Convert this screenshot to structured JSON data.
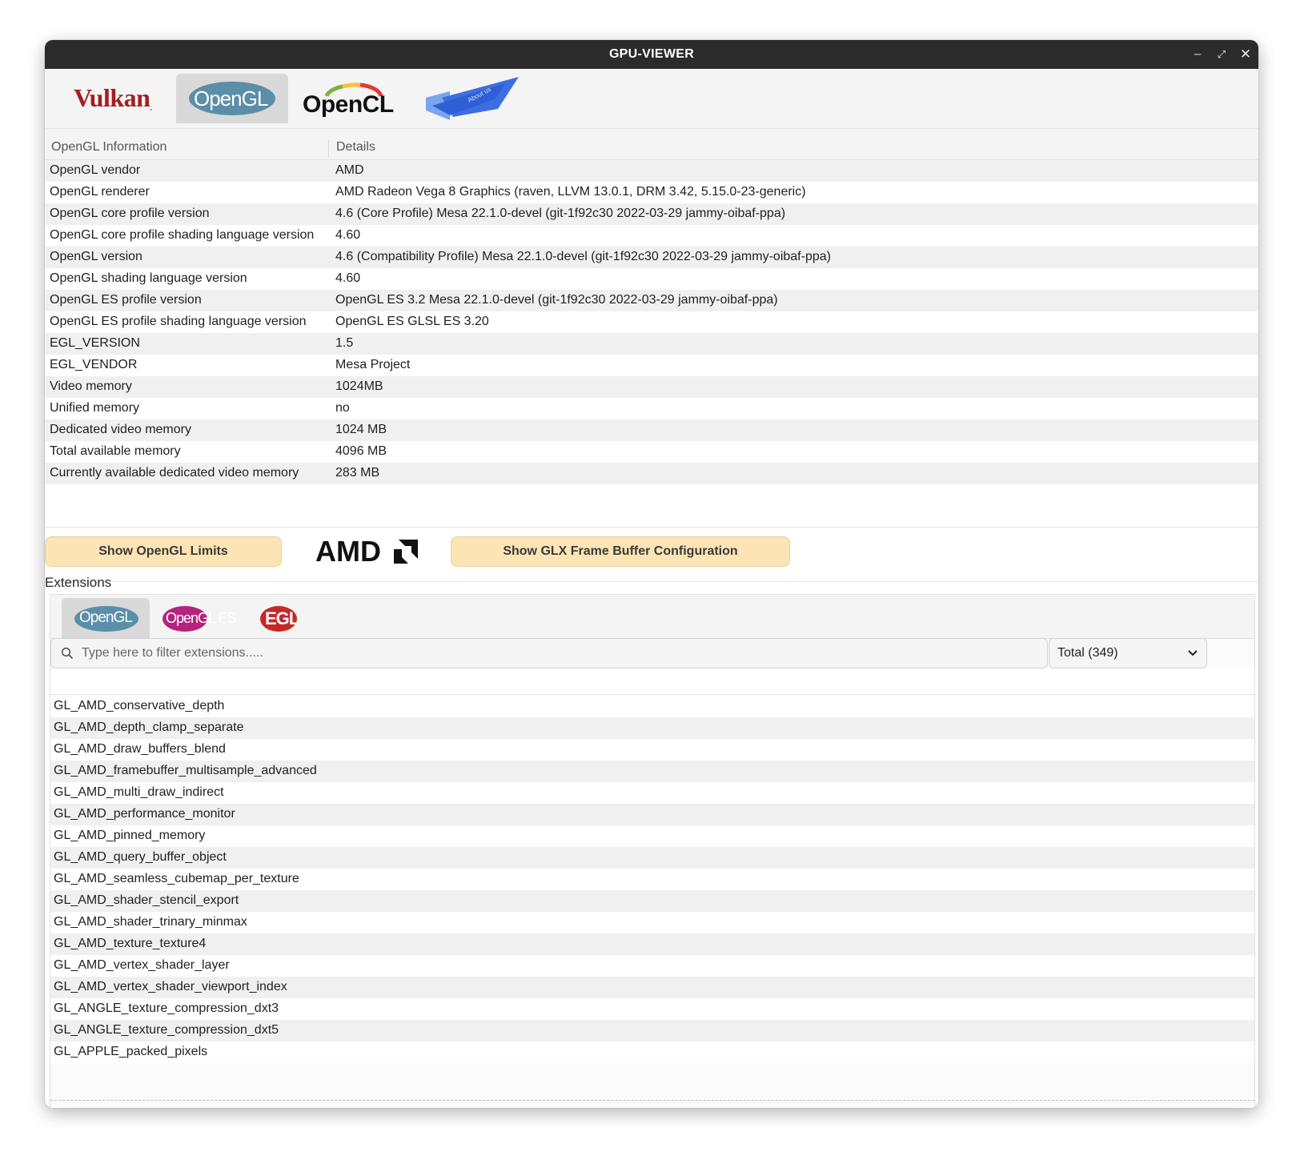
{
  "window": {
    "title": "GPU-VIEWER",
    "minimize": "–",
    "maximize": "⤢",
    "close": "✕"
  },
  "api_tabs": [
    {
      "label": "Vulkan",
      "active": false
    },
    {
      "label": "OpenGL",
      "active": true
    },
    {
      "label": "OpenCL",
      "active": false
    },
    {
      "label": "About us",
      "active": false
    }
  ],
  "info_table": {
    "headers": [
      "OpenGL Information",
      "Details"
    ],
    "rows": [
      [
        "OpenGL vendor",
        "AMD"
      ],
      [
        "OpenGL renderer",
        "AMD Radeon Vega 8 Graphics (raven, LLVM 13.0.1, DRM 3.42, 5.15.0-23-generic)"
      ],
      [
        "OpenGL core profile version",
        "4.6 (Core Profile) Mesa 22.1.0-devel (git-1f92c30 2022-03-29 jammy-oibaf-ppa)"
      ],
      [
        "OpenGL core profile shading language version",
        "4.60"
      ],
      [
        "OpenGL version",
        "4.6 (Compatibility Profile) Mesa 22.1.0-devel (git-1f92c30 2022-03-29 jammy-oibaf-ppa)"
      ],
      [
        "OpenGL shading language version",
        "4.60"
      ],
      [
        "OpenGL ES profile version",
        "OpenGL ES 3.2 Mesa 22.1.0-devel (git-1f92c30 2022-03-29 jammy-oibaf-ppa)"
      ],
      [
        "OpenGL ES profile shading language version",
        "OpenGL ES GLSL ES 3.20"
      ],
      [
        "EGL_VERSION",
        "1.5"
      ],
      [
        "EGL_VENDOR",
        "Mesa Project"
      ],
      [
        "Video memory",
        "1024MB"
      ],
      [
        "Unified memory",
        "no"
      ],
      [
        "Dedicated video memory",
        "1024 MB"
      ],
      [
        "Total available memory",
        "4096 MB"
      ],
      [
        "Currently available dedicated video memory",
        "283 MB"
      ]
    ]
  },
  "buttons": {
    "limits": "Show OpenGL Limits",
    "glx": "Show GLX Frame Buffer Configuration",
    "vendor_logo": "AMD"
  },
  "extensions": {
    "label": "Extensions",
    "tabs": [
      {
        "label": "OpenGL",
        "active": true
      },
      {
        "label": "OpenGL ES",
        "active": false
      },
      {
        "label": "EGL",
        "active": false
      }
    ],
    "search_placeholder": "Type here to filter extensions.....",
    "total": "Total (349)",
    "items": [
      "GL_AMD_conservative_depth",
      "GL_AMD_depth_clamp_separate",
      "GL_AMD_draw_buffers_blend",
      "GL_AMD_framebuffer_multisample_advanced",
      "GL_AMD_multi_draw_indirect",
      "GL_AMD_performance_monitor",
      "GL_AMD_pinned_memory",
      "GL_AMD_query_buffer_object",
      "GL_AMD_seamless_cubemap_per_texture",
      "GL_AMD_shader_stencil_export",
      "GL_AMD_shader_trinary_minmax",
      "GL_AMD_texture_texture4",
      "GL_AMD_vertex_shader_layer",
      "GL_AMD_vertex_shader_viewport_index",
      "GL_ANGLE_texture_compression_dxt3",
      "GL_ANGLE_texture_compression_dxt5",
      "GL_APPLE_packed_pixels"
    ]
  },
  "colors": {
    "titlebar": "#2b2b2b",
    "vulkan_red": "#a41e22",
    "opengl_blue": "#5b8ea8",
    "button_fill": "#fde4b5",
    "egl_red": "#c62828",
    "opengles_magenta": "#b5237f"
  }
}
